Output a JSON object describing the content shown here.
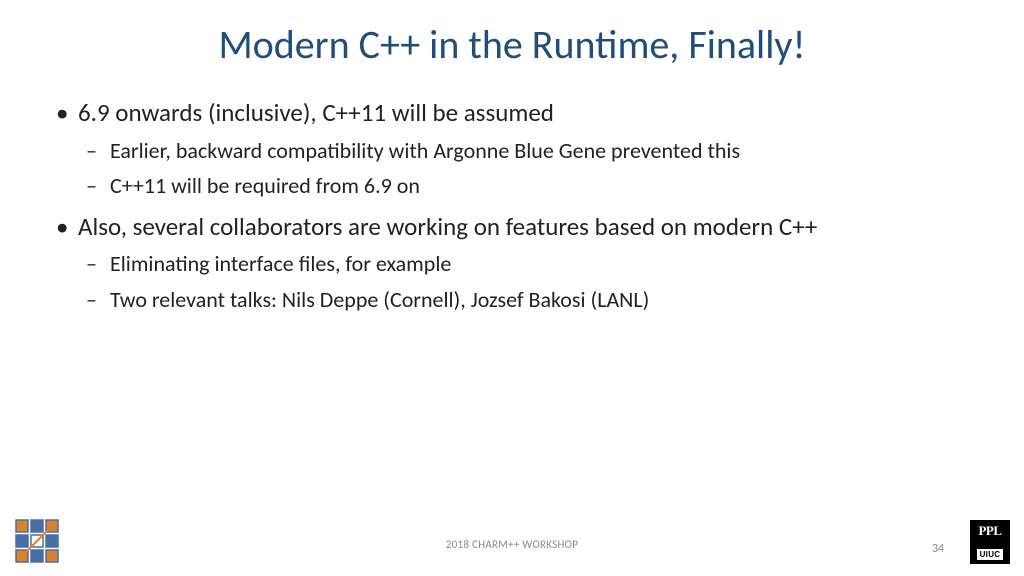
{
  "title": "Modern C++ in the Runtime, Finally!",
  "bullets": {
    "b1": "6.9 onwards (inclusive), C++11 will be assumed",
    "b1_1": "Earlier, backward compatibility with Argonne Blue Gene prevented this",
    "b1_2": "C++11 will be required from 6.9 on",
    "b2": "Also, several collaborators are working on features based on modern C++",
    "b2_1": "Eliminating interface files, for example",
    "b2_2": "Two relevant talks: Nils Deppe (Cornell), Jozsef Bakosi (LANL)"
  },
  "footer": {
    "text": "2018 CHARM++ WORKSHOP",
    "page": "34"
  },
  "logos": {
    "right_top": "PPL",
    "right_bottom": "UIUC"
  }
}
